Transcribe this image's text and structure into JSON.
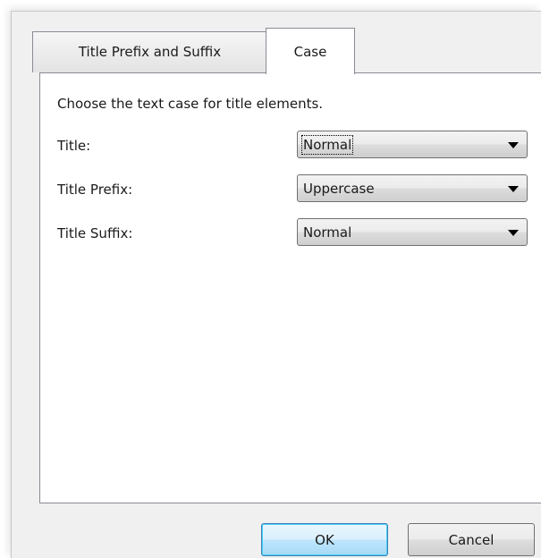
{
  "tabs": [
    {
      "label": "Title Prefix and Suffix",
      "active": false
    },
    {
      "label": "Case",
      "active": true
    }
  ],
  "panel": {
    "instruction": "Choose the text case for title elements.",
    "rows": [
      {
        "label": "Title:",
        "value": "Normal"
      },
      {
        "label": "Title Prefix:",
        "value": "Uppercase"
      },
      {
        "label": "Title Suffix:",
        "value": "Normal"
      }
    ]
  },
  "buttons": {
    "ok": "OK",
    "cancel": "Cancel"
  },
  "colors": {
    "dialog_background": "#f0f0f0",
    "panel_background": "#ffffff",
    "default_button_accent": "#3c7fb1"
  },
  "icons": {
    "dropdown": "chevron-down-icon"
  }
}
